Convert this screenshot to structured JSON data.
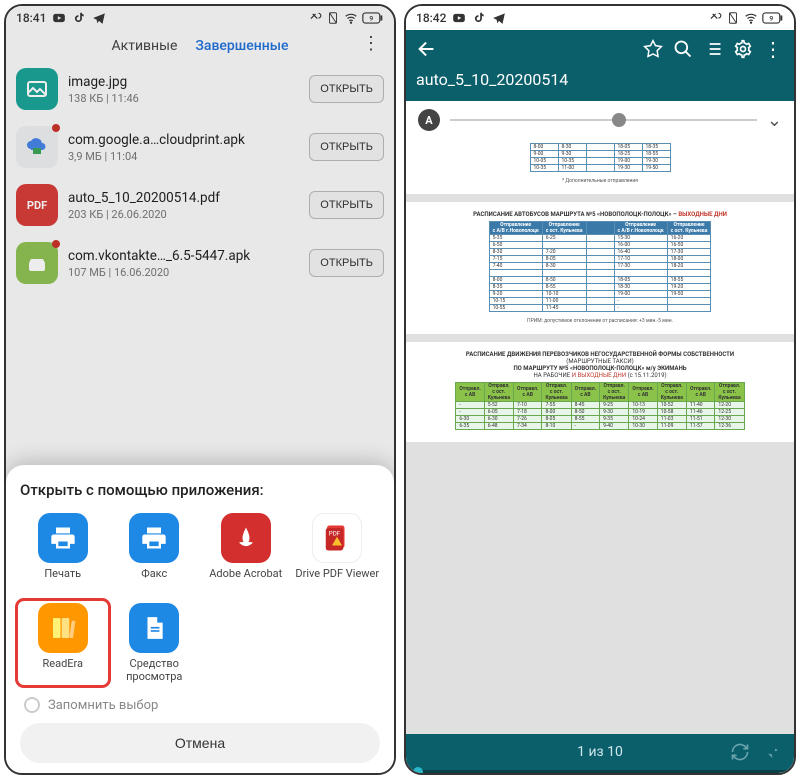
{
  "left": {
    "status": {
      "time": "18:41"
    },
    "tabs": {
      "active": "Активные",
      "completed": "Завершенные"
    },
    "open_label": "ОТКРЫТЬ",
    "files": [
      {
        "name": "image.jpg",
        "meta": "138 КБ | 11:46",
        "icon": "image",
        "color": "#0fa89a",
        "badge": false
      },
      {
        "name": "com.google.a…cloudprint.apk",
        "meta": "3,9 МБ | 11:04",
        "icon": "cloud-print",
        "color": "#eceff1",
        "badge": true
      },
      {
        "name": "auto_5_10_20200514.pdf",
        "meta": "203 КБ | 26.06.2020",
        "icon": "pdf",
        "color": "#e53935",
        "badge": false
      },
      {
        "name": "com.vkontakte…_6.5-5447.apk",
        "meta": "107 МБ | 16.06.2020",
        "icon": "apk",
        "color": "#8bc34a",
        "badge": true
      }
    ],
    "sheet": {
      "title": "Открыть с помощью приложения:",
      "apps": [
        {
          "label": "Печать",
          "icon": "print",
          "color": "#1e88e5"
        },
        {
          "label": "Факс",
          "icon": "fax",
          "color": "#1e88e5"
        },
        {
          "label": "Adobe Acrobat",
          "icon": "acrobat",
          "color": "#d32f2f"
        },
        {
          "label": "Drive PDF Viewer",
          "icon": "drive-pdf",
          "color": "#e53935"
        },
        {
          "label": "ReadEra",
          "icon": "readera",
          "color": "#ff9800",
          "highlight": true
        },
        {
          "label": "Средство просмотра",
          "icon": "doc-viewer",
          "color": "#1e88e5"
        }
      ],
      "remember": "Запомнить выбор",
      "cancel": "Отмена"
    }
  },
  "right": {
    "status": {
      "time": "18:42"
    },
    "title": "auto_5_10_20200514",
    "page_indicator": "1 из 10",
    "doc": {
      "p1_note": "* Дополнительные отправления",
      "p2_title": "РАСПИСАНИЕ АВТОБУСОВ МАРШРУТА №5 «НОВОПОЛОЦК-ПОЛОЦК» –",
      "p2_title_red": "ВЫХОДНЫЕ ДНИ",
      "p2_note": "ПРИМ: допустимое отклонение от расписания: +3 мин.-5 мин.",
      "p3_title1": "РАСПИСАНИЕ ДВИЖЕНИЯ ПЕРЕВОЗЧИКОВ НЕГОСУДАРСТВЕННОЙ ФОРМЫ СОБСТВЕННОСТИ",
      "p3_title2": "(МАРШРУТНЫЕ ТАКСИ)",
      "p3_title3": "ПО МАРШРУТУ №5 «НОВОПОЛОЦК-ПОЛОЦК» м/у ЭКИМАНЬ",
      "p3_title4_a": "НА РАБОЧИЕ",
      "p3_title4_b": "И ВЫХОДНЫЕ ДНИ",
      "p3_title4_c": "(с 15.11.2019)"
    }
  }
}
